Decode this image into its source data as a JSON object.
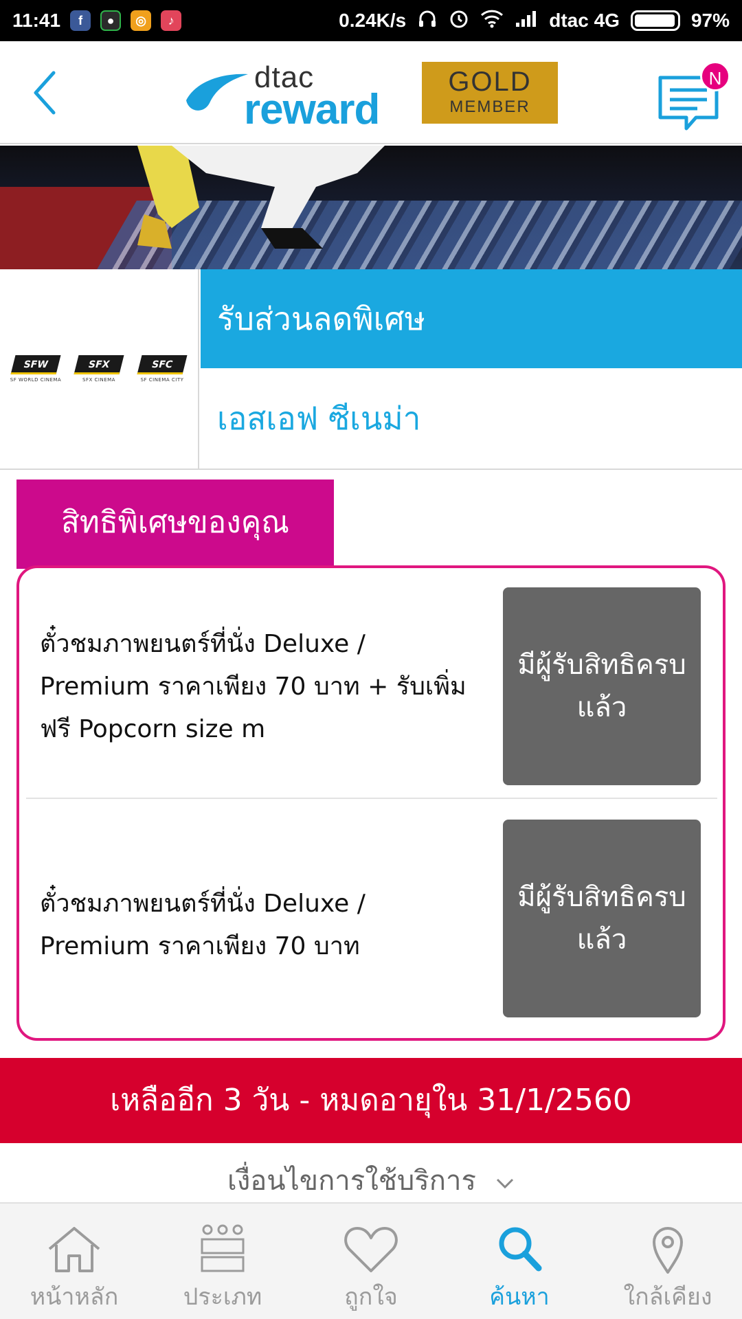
{
  "status_bar": {
    "time": "11:41",
    "net_speed": "0.24K/s",
    "carrier": "dtac 4G",
    "battery": "97%",
    "battery_level": 0.97
  },
  "header": {
    "logo_top": "dtac",
    "logo_bottom": "reward",
    "badge_line1": "GOLD",
    "badge_line2": "MEMBER",
    "notification_badge": "N"
  },
  "brand": {
    "title": "รับส่วนลดพิเศษ",
    "name": "เอสเอฟ ซีเนม่า",
    "logos": [
      {
        "chip": "SFW",
        "caption": "SF WORLD CINEMA"
      },
      {
        "chip": "SFX",
        "caption": "SFX CINEMA"
      },
      {
        "chip": "SFC",
        "caption": "SF CINEMA CITY"
      }
    ]
  },
  "privileges": {
    "tab_label": "สิทธิพิเศษของคุณ",
    "items": [
      {
        "text": "ตั๋วชมภาพยนตร์ที่นั่ง Deluxe / Premium ราคาเพียง 70 บาท + รับเพิ่มฟรี Popcorn size m",
        "button": "มีผู้รับสิทธิครบแล้ว"
      },
      {
        "text": "ตั๋วชมภาพยนตร์ที่นั่ง Deluxe / Premium ราคาเพียง 70 บาท",
        "button": "มีผู้รับสิทธิครบแล้ว"
      }
    ]
  },
  "expiry": {
    "text": "เหลืออีก 3 วัน - หมดอายุใน 31/1/2560"
  },
  "terms": {
    "label": "เงื่อนไขการใช้บริการ"
  },
  "bottom_nav": {
    "items": [
      {
        "label": "หน้าหลัก",
        "icon": "home-icon"
      },
      {
        "label": "ประเภท",
        "icon": "category-icon"
      },
      {
        "label": "ถูกใจ",
        "icon": "heart-icon"
      },
      {
        "label": "ค้นหา",
        "icon": "search-icon",
        "active": true
      },
      {
        "label": "ใกล้เคียง",
        "icon": "location-pin-icon"
      }
    ]
  },
  "colors": {
    "brand_blue": "#1aa8e0",
    "privilege_magenta": "#cc0a8c",
    "expiry_red": "#d6002d",
    "claimed_gray": "#666666",
    "gold": "#cf9b1b"
  }
}
